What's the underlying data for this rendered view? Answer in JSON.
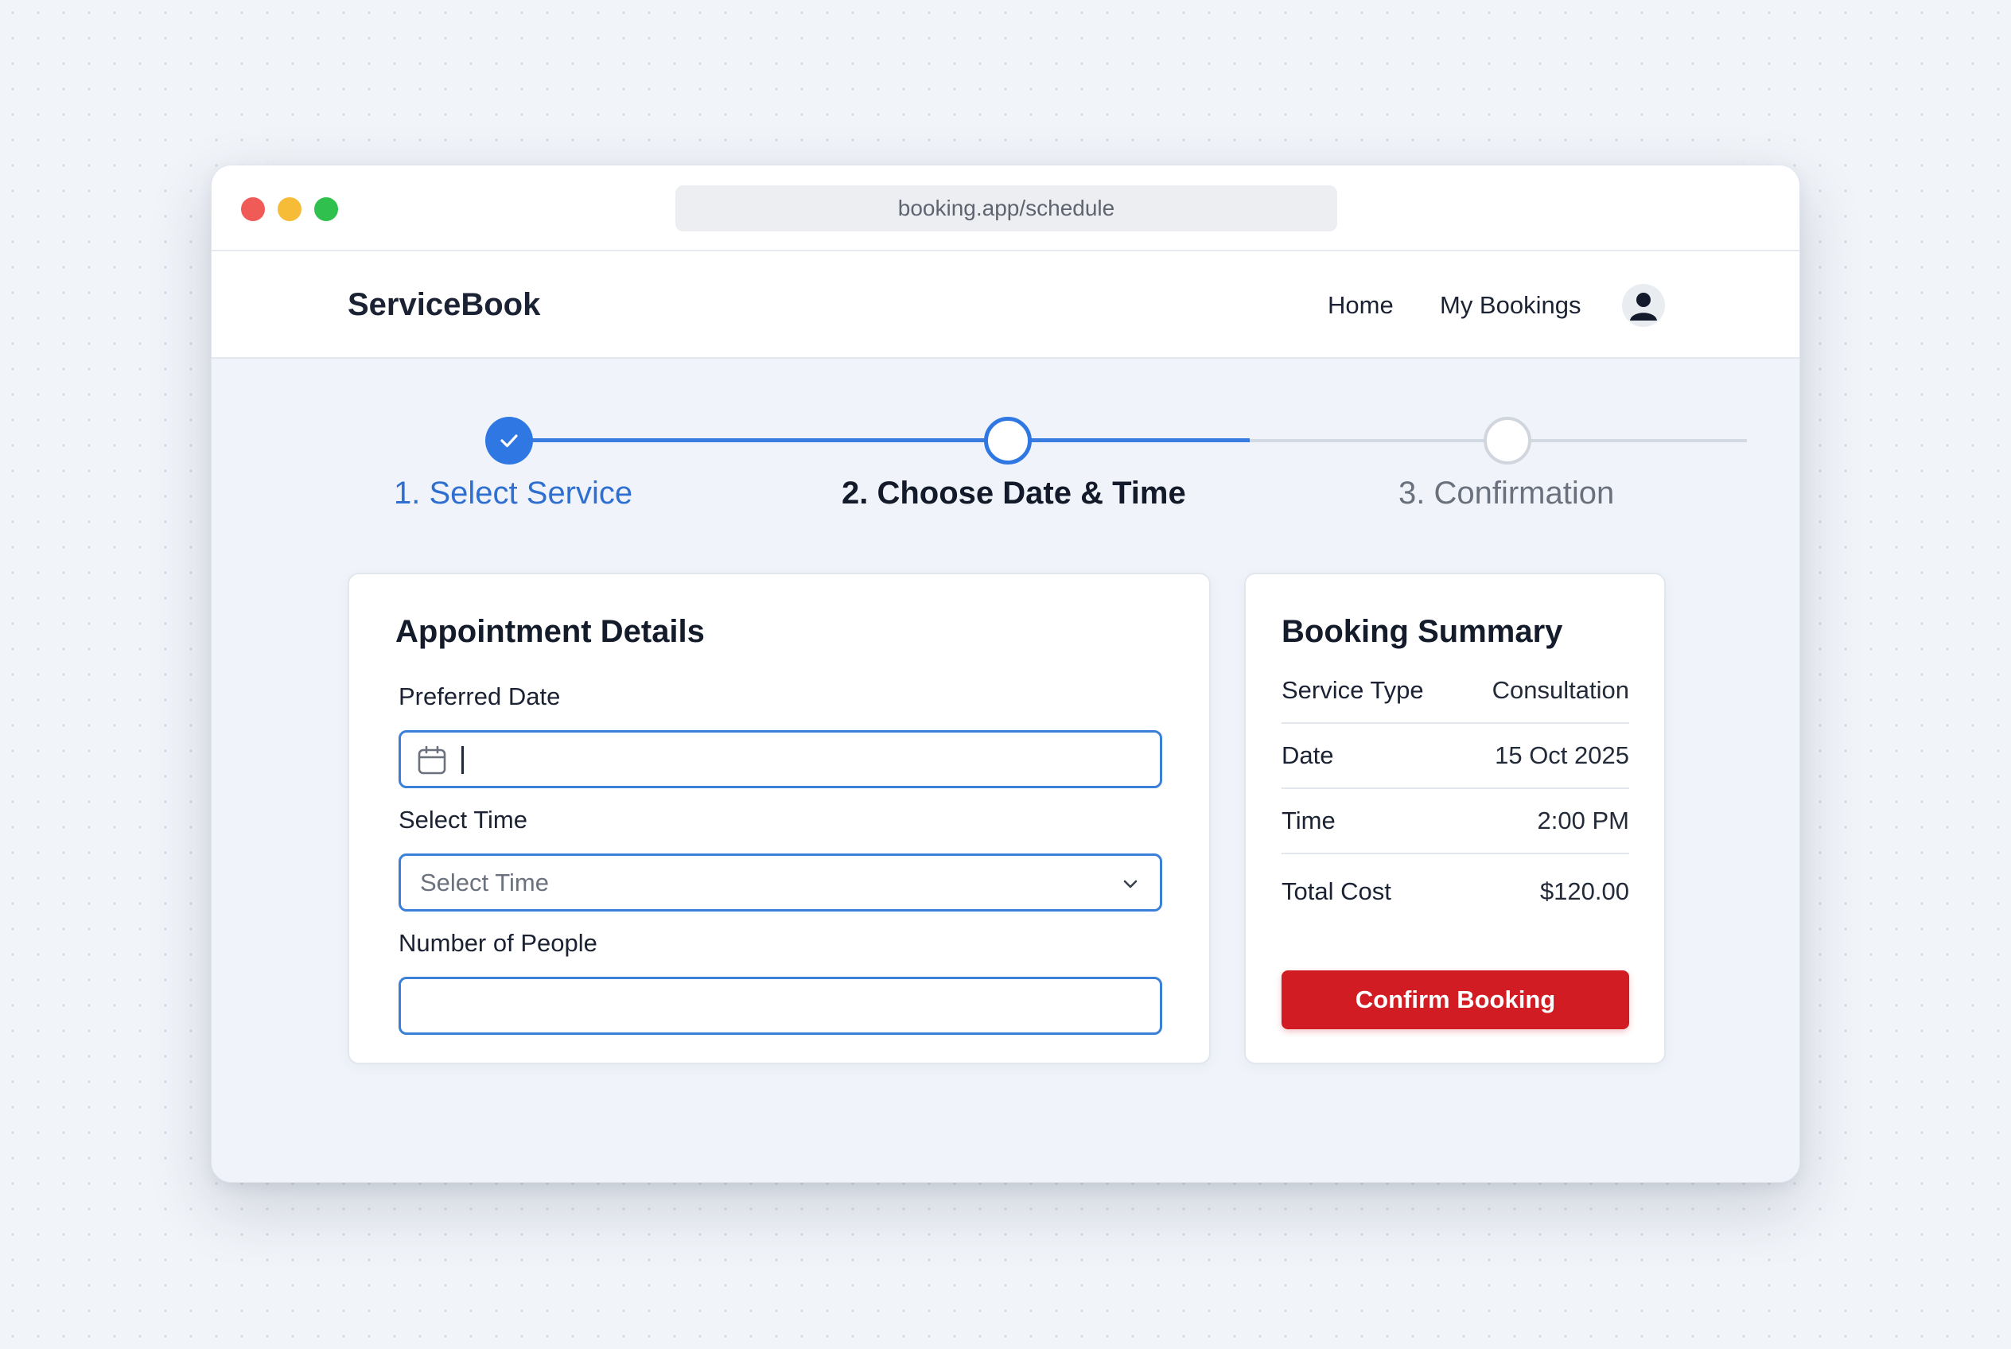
{
  "browser": {
    "url": "booking.app/schedule"
  },
  "nav": {
    "brand": "ServiceBook",
    "links": [
      "Home",
      "My Bookings"
    ]
  },
  "stepper": {
    "steps": [
      {
        "label": "1. Select Service",
        "state": "completed"
      },
      {
        "label": "2. Choose Date & Time",
        "state": "current"
      },
      {
        "label": "3. Confirmation",
        "state": "upcoming"
      }
    ]
  },
  "appointment": {
    "title": "Appointment Details",
    "date_label": "Preferred Date",
    "date_value": "",
    "time_label": "Select Time",
    "time_placeholder": "Select Time",
    "people_label": "Number of People",
    "people_value": ""
  },
  "summary": {
    "title": "Booking Summary",
    "rows": [
      {
        "label": "Service Type",
        "value": "Consultation"
      },
      {
        "label": "Date",
        "value": "15 Oct 2025"
      },
      {
        "label": "Time",
        "value": "2:00 PM"
      },
      {
        "label": "Total Cost",
        "value": "$120.00"
      }
    ],
    "confirm_label": "Confirm Booking"
  },
  "colors": {
    "accent_blue": "#2f78e4",
    "confirm_red": "#d01c22",
    "window_close": "#f05a57",
    "window_minimize": "#f6bb37",
    "window_maximize": "#2fc04e"
  },
  "icons": {
    "date_field": "calendar-icon",
    "time_field": "chevron-down-icon",
    "account": "user-avatar-icon",
    "step_completed": "checkmark-icon"
  }
}
